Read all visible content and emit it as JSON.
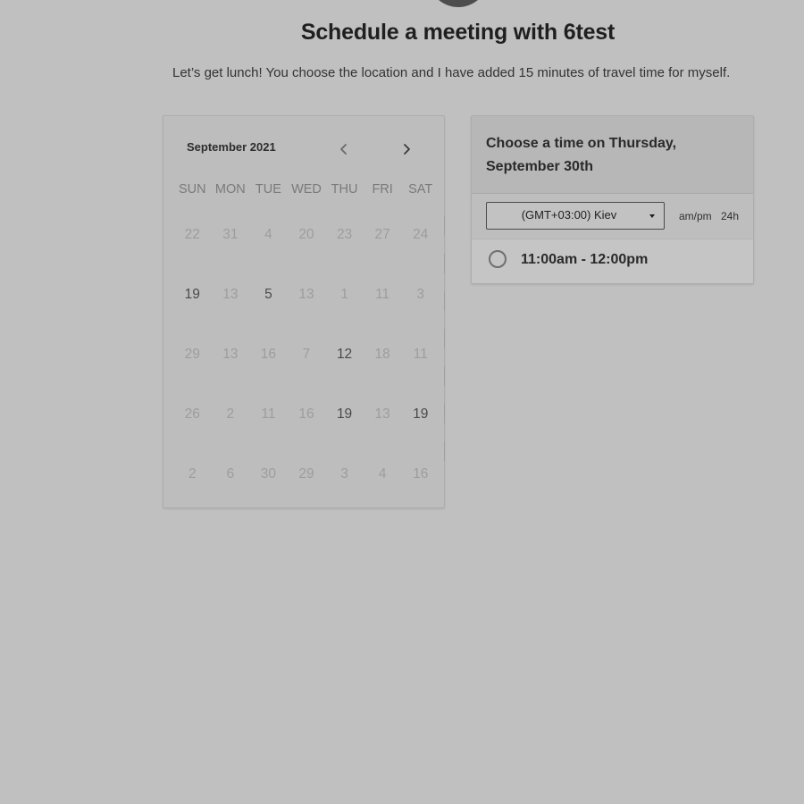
{
  "header": {
    "title": "Schedule a meeting with 6test",
    "subtitle": "Let’s get lunch! You choose the location and I have added 15 minutes of travel time for myself."
  },
  "calendar": {
    "month_label": "September 2021",
    "prev_icon": "chevron-left-icon",
    "next_icon": "chevron-right-icon",
    "weekdays": [
      "SUN",
      "MON",
      "TUE",
      "WED",
      "THU",
      "FRI",
      "SAT"
    ],
    "weeks": [
      [
        {
          "d": "22",
          "a": false
        },
        {
          "d": "31",
          "a": false
        },
        {
          "d": "4",
          "a": false
        },
        {
          "d": "20",
          "a": false
        },
        {
          "d": "23",
          "a": false
        },
        {
          "d": "27",
          "a": false
        },
        {
          "d": "24",
          "a": false
        }
      ],
      [
        {
          "d": "19",
          "a": true
        },
        {
          "d": "13",
          "a": false
        },
        {
          "d": "5",
          "a": true
        },
        {
          "d": "13",
          "a": false
        },
        {
          "d": "1",
          "a": false
        },
        {
          "d": "11",
          "a": false
        },
        {
          "d": "3",
          "a": false
        }
      ],
      [
        {
          "d": "29",
          "a": false
        },
        {
          "d": "13",
          "a": false
        },
        {
          "d": "16",
          "a": false
        },
        {
          "d": "7",
          "a": false
        },
        {
          "d": "12",
          "a": true
        },
        {
          "d": "18",
          "a": false
        },
        {
          "d": "11",
          "a": false
        }
      ],
      [
        {
          "d": "26",
          "a": false
        },
        {
          "d": "2",
          "a": false
        },
        {
          "d": "11",
          "a": false
        },
        {
          "d": "16",
          "a": false
        },
        {
          "d": "19",
          "a": true
        },
        {
          "d": "13",
          "a": false
        },
        {
          "d": "19",
          "a": true
        }
      ],
      [
        {
          "d": "2",
          "a": false
        },
        {
          "d": "6",
          "a": false
        },
        {
          "d": "30",
          "a": false
        },
        {
          "d": "29",
          "a": false
        },
        {
          "d": "3",
          "a": false
        },
        {
          "d": "4",
          "a": false
        },
        {
          "d": "16",
          "a": false
        }
      ]
    ]
  },
  "time_panel": {
    "title": "Choose a time on Thursday, September 30th",
    "timezone": "(GMT+03:00) Kiev",
    "format_ampm": "am/pm",
    "format_24h": "24h",
    "slots": [
      "11:00am - 12:00pm"
    ]
  },
  "colors": {
    "background": "#c0c0c0",
    "available_day": "#4a4a4a",
    "unavailable_day": "#9d9d9d"
  }
}
